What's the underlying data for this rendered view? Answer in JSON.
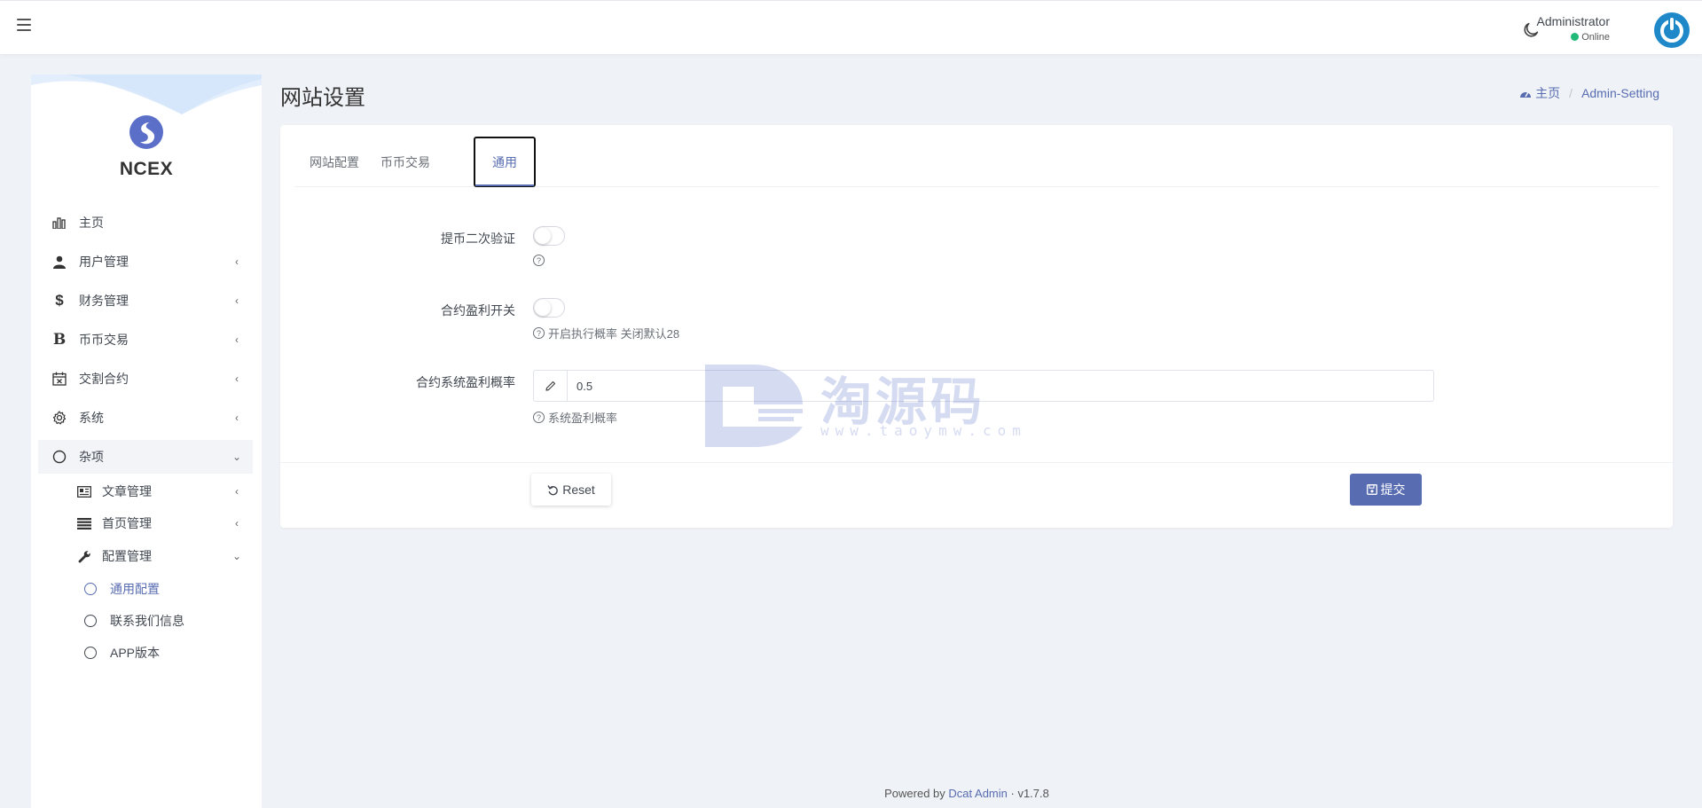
{
  "header": {
    "user_name": "Administrator",
    "user_status": "Online"
  },
  "sidebar": {
    "logo_text": "NCEX",
    "items": [
      {
        "label": "主页",
        "icon": "bar-chart-icon"
      },
      {
        "label": "用户管理",
        "icon": "users-icon"
      },
      {
        "label": "财务管理",
        "icon": "dollar-icon"
      },
      {
        "label": "币币交易",
        "icon": "bitcoin-icon"
      },
      {
        "label": "交割合约",
        "icon": "calendar-x-icon"
      },
      {
        "label": "系统",
        "icon": "gear-icon"
      },
      {
        "label": "杂项",
        "icon": "circle-icon"
      }
    ],
    "sub_items": [
      {
        "label": "文章管理",
        "icon": "newspaper-icon"
      },
      {
        "label": "首页管理",
        "icon": "list-icon"
      },
      {
        "label": "配置管理",
        "icon": "wrench-icon"
      }
    ],
    "config_items": [
      {
        "label": "通用配置",
        "active": true
      },
      {
        "label": "联系我们信息",
        "active": false
      },
      {
        "label": "APP版本",
        "active": false
      }
    ]
  },
  "page": {
    "title": "网站设置",
    "breadcrumb_home": "主页",
    "breadcrumb_current": "Admin-Setting"
  },
  "tabs": [
    {
      "label": "网站配置"
    },
    {
      "label": "币币交易"
    },
    {
      "label": "通用"
    }
  ],
  "form": {
    "withdraw_2fa_label": "提币二次验证",
    "contract_profit_switch_label": "合约盈利开关",
    "contract_profit_switch_help": "开启执行概率 关闭默认28",
    "contract_profit_rate_label": "合约系统盈利概率",
    "contract_profit_rate_value": "0.5",
    "contract_profit_rate_help": "系统盈利概率",
    "reset_label": "Reset",
    "submit_label": "提交"
  },
  "watermark": {
    "text": "淘源码",
    "url": "www.taoymw.com"
  },
  "footer": {
    "powered_prefix": "Powered by",
    "powered_link": "Dcat Admin",
    "version": "· v1.7.8"
  },
  "colors": {
    "primary": "#586cb1",
    "online": "#21b978",
    "avatar": "#1e88c9"
  }
}
